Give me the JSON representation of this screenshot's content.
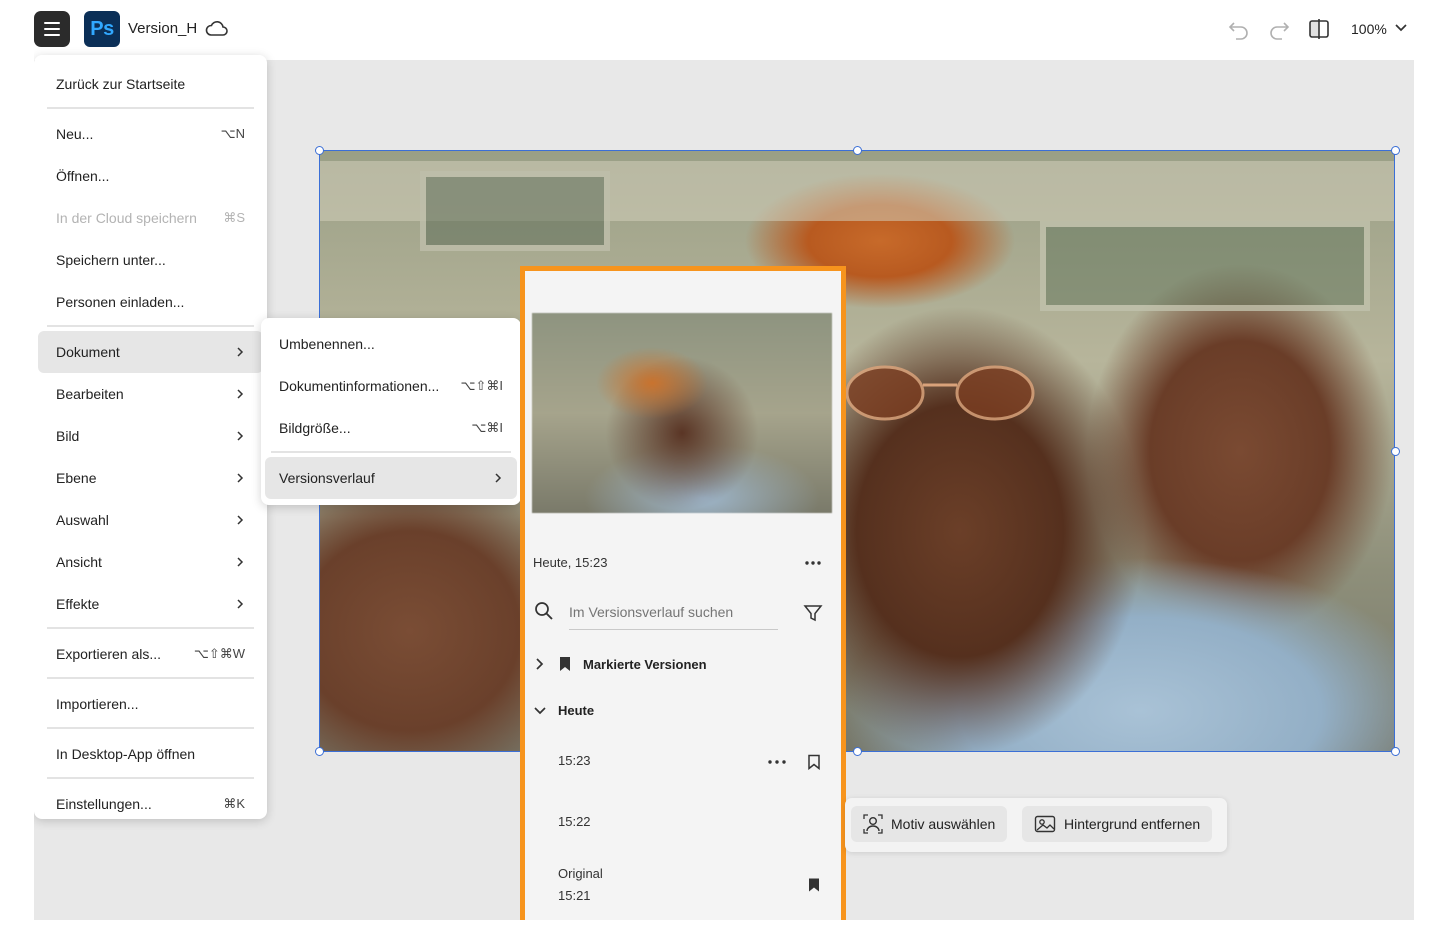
{
  "app": {
    "logo_text": "Ps",
    "document_title": "Version_H",
    "zoom_label": "100%"
  },
  "main_menu": {
    "items": [
      {
        "label": "Zurück zur Startseite",
        "shortcut": ""
      },
      {
        "label": "Neu...",
        "shortcut": "⌥N"
      },
      {
        "label": "Öffnen...",
        "shortcut": ""
      },
      {
        "label": "In der Cloud speichern",
        "shortcut": "⌘S"
      },
      {
        "label": "Speichern unter...",
        "shortcut": ""
      },
      {
        "label": "Personen einladen...",
        "shortcut": ""
      },
      {
        "label": "Dokument",
        "shortcut": ""
      },
      {
        "label": "Bearbeiten",
        "shortcut": ""
      },
      {
        "label": "Bild",
        "shortcut": ""
      },
      {
        "label": "Ebene",
        "shortcut": ""
      },
      {
        "label": "Auswahl",
        "shortcut": ""
      },
      {
        "label": "Ansicht",
        "shortcut": ""
      },
      {
        "label": "Effekte",
        "shortcut": ""
      },
      {
        "label": "Exportieren als...",
        "shortcut": "⌥⇧⌘W"
      },
      {
        "label": "Importieren...",
        "shortcut": ""
      },
      {
        "label": "In Desktop-App öffnen",
        "shortcut": ""
      },
      {
        "label": "Einstellungen...",
        "shortcut": "⌘K"
      }
    ]
  },
  "document_submenu": {
    "items": [
      {
        "label": "Umbenennen...",
        "shortcut": ""
      },
      {
        "label": "Dokumentinformationen...",
        "shortcut": "⌥⇧⌘I"
      },
      {
        "label": "Bildgröße...",
        "shortcut": "⌥⌘I"
      },
      {
        "label": "Versionsverlauf",
        "shortcut": ""
      }
    ]
  },
  "version_panel": {
    "current_date": "Heute, 15:23",
    "search_placeholder": "Im Versionsverlauf suchen",
    "marked_group_label": "Markierte Versionen",
    "today_group_label": "Heute",
    "versions": [
      {
        "time": "15:23",
        "name": ""
      },
      {
        "time": "15:22",
        "name": ""
      },
      {
        "time": "15:21",
        "name": "Original"
      }
    ]
  },
  "context_bar": {
    "select_subject_label": "Motiv auswählen",
    "remove_background_label": "Hintergrund entfernen"
  },
  "colors": {
    "panel_highlight": "#f7941d",
    "selection_blue": "#3b6fd6",
    "ps_brand_bg": "#0b2f57",
    "ps_brand_fg": "#31a8ff"
  }
}
